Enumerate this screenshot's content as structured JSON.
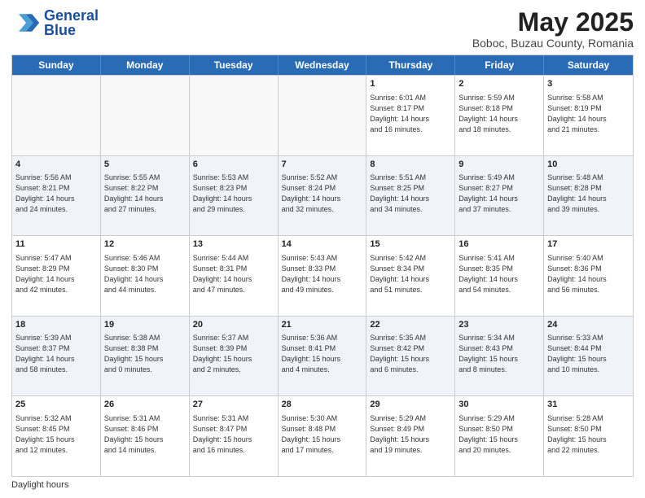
{
  "logo": {
    "name_line1": "General",
    "name_line2": "Blue"
  },
  "title": {
    "month_year": "May 2025",
    "location": "Boboc, Buzau County, Romania"
  },
  "weekdays": [
    "Sunday",
    "Monday",
    "Tuesday",
    "Wednesday",
    "Thursday",
    "Friday",
    "Saturday"
  ],
  "rows": [
    [
      {
        "day": "",
        "info": "",
        "empty": true
      },
      {
        "day": "",
        "info": "",
        "empty": true
      },
      {
        "day": "",
        "info": "",
        "empty": true
      },
      {
        "day": "",
        "info": "",
        "empty": true
      },
      {
        "day": "1",
        "info": "Sunrise: 6:01 AM\nSunset: 8:17 PM\nDaylight: 14 hours\nand 16 minutes.",
        "empty": false
      },
      {
        "day": "2",
        "info": "Sunrise: 5:59 AM\nSunset: 8:18 PM\nDaylight: 14 hours\nand 18 minutes.",
        "empty": false
      },
      {
        "day": "3",
        "info": "Sunrise: 5:58 AM\nSunset: 8:19 PM\nDaylight: 14 hours\nand 21 minutes.",
        "empty": false
      }
    ],
    [
      {
        "day": "4",
        "info": "Sunrise: 5:56 AM\nSunset: 8:21 PM\nDaylight: 14 hours\nand 24 minutes.",
        "empty": false
      },
      {
        "day": "5",
        "info": "Sunrise: 5:55 AM\nSunset: 8:22 PM\nDaylight: 14 hours\nand 27 minutes.",
        "empty": false
      },
      {
        "day": "6",
        "info": "Sunrise: 5:53 AM\nSunset: 8:23 PM\nDaylight: 14 hours\nand 29 minutes.",
        "empty": false
      },
      {
        "day": "7",
        "info": "Sunrise: 5:52 AM\nSunset: 8:24 PM\nDaylight: 14 hours\nand 32 minutes.",
        "empty": false
      },
      {
        "day": "8",
        "info": "Sunrise: 5:51 AM\nSunset: 8:25 PM\nDaylight: 14 hours\nand 34 minutes.",
        "empty": false
      },
      {
        "day": "9",
        "info": "Sunrise: 5:49 AM\nSunset: 8:27 PM\nDaylight: 14 hours\nand 37 minutes.",
        "empty": false
      },
      {
        "day": "10",
        "info": "Sunrise: 5:48 AM\nSunset: 8:28 PM\nDaylight: 14 hours\nand 39 minutes.",
        "empty": false
      }
    ],
    [
      {
        "day": "11",
        "info": "Sunrise: 5:47 AM\nSunset: 8:29 PM\nDaylight: 14 hours\nand 42 minutes.",
        "empty": false
      },
      {
        "day": "12",
        "info": "Sunrise: 5:46 AM\nSunset: 8:30 PM\nDaylight: 14 hours\nand 44 minutes.",
        "empty": false
      },
      {
        "day": "13",
        "info": "Sunrise: 5:44 AM\nSunset: 8:31 PM\nDaylight: 14 hours\nand 47 minutes.",
        "empty": false
      },
      {
        "day": "14",
        "info": "Sunrise: 5:43 AM\nSunset: 8:33 PM\nDaylight: 14 hours\nand 49 minutes.",
        "empty": false
      },
      {
        "day": "15",
        "info": "Sunrise: 5:42 AM\nSunset: 8:34 PM\nDaylight: 14 hours\nand 51 minutes.",
        "empty": false
      },
      {
        "day": "16",
        "info": "Sunrise: 5:41 AM\nSunset: 8:35 PM\nDaylight: 14 hours\nand 54 minutes.",
        "empty": false
      },
      {
        "day": "17",
        "info": "Sunrise: 5:40 AM\nSunset: 8:36 PM\nDaylight: 14 hours\nand 56 minutes.",
        "empty": false
      }
    ],
    [
      {
        "day": "18",
        "info": "Sunrise: 5:39 AM\nSunset: 8:37 PM\nDaylight: 14 hours\nand 58 minutes.",
        "empty": false
      },
      {
        "day": "19",
        "info": "Sunrise: 5:38 AM\nSunset: 8:38 PM\nDaylight: 15 hours\nand 0 minutes.",
        "empty": false
      },
      {
        "day": "20",
        "info": "Sunrise: 5:37 AM\nSunset: 8:39 PM\nDaylight: 15 hours\nand 2 minutes.",
        "empty": false
      },
      {
        "day": "21",
        "info": "Sunrise: 5:36 AM\nSunset: 8:41 PM\nDaylight: 15 hours\nand 4 minutes.",
        "empty": false
      },
      {
        "day": "22",
        "info": "Sunrise: 5:35 AM\nSunset: 8:42 PM\nDaylight: 15 hours\nand 6 minutes.",
        "empty": false
      },
      {
        "day": "23",
        "info": "Sunrise: 5:34 AM\nSunset: 8:43 PM\nDaylight: 15 hours\nand 8 minutes.",
        "empty": false
      },
      {
        "day": "24",
        "info": "Sunrise: 5:33 AM\nSunset: 8:44 PM\nDaylight: 15 hours\nand 10 minutes.",
        "empty": false
      }
    ],
    [
      {
        "day": "25",
        "info": "Sunrise: 5:32 AM\nSunset: 8:45 PM\nDaylight: 15 hours\nand 12 minutes.",
        "empty": false
      },
      {
        "day": "26",
        "info": "Sunrise: 5:31 AM\nSunset: 8:46 PM\nDaylight: 15 hours\nand 14 minutes.",
        "empty": false
      },
      {
        "day": "27",
        "info": "Sunrise: 5:31 AM\nSunset: 8:47 PM\nDaylight: 15 hours\nand 16 minutes.",
        "empty": false
      },
      {
        "day": "28",
        "info": "Sunrise: 5:30 AM\nSunset: 8:48 PM\nDaylight: 15 hours\nand 17 minutes.",
        "empty": false
      },
      {
        "day": "29",
        "info": "Sunrise: 5:29 AM\nSunset: 8:49 PM\nDaylight: 15 hours\nand 19 minutes.",
        "empty": false
      },
      {
        "day": "30",
        "info": "Sunrise: 5:29 AM\nSunset: 8:50 PM\nDaylight: 15 hours\nand 20 minutes.",
        "empty": false
      },
      {
        "day": "31",
        "info": "Sunrise: 5:28 AM\nSunset: 8:50 PM\nDaylight: 15 hours\nand 22 minutes.",
        "empty": false
      }
    ]
  ],
  "footer": {
    "daylight_label": "Daylight hours"
  }
}
